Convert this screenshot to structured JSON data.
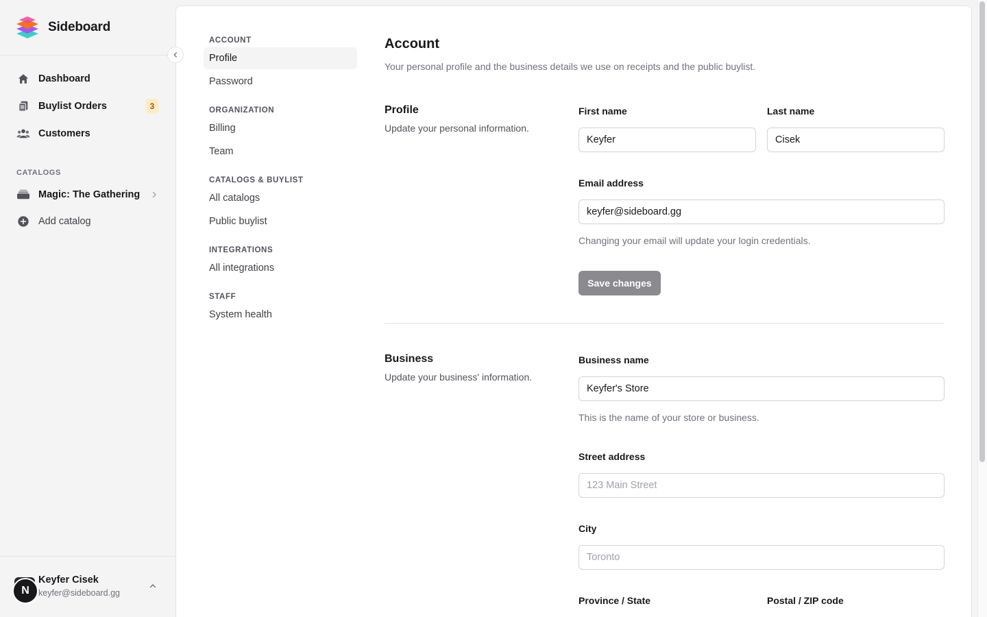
{
  "app": {
    "name": "Sideboard"
  },
  "sidebar": {
    "nav": [
      {
        "label": "Dashboard",
        "icon": "home-icon"
      },
      {
        "label": "Buylist Orders",
        "icon": "orders-icon",
        "badge": "3"
      },
      {
        "label": "Customers",
        "icon": "users-icon"
      }
    ],
    "catalogs_title": "CATALOGS",
    "catalogs": [
      {
        "label": "Magic: The Gathering",
        "icon": "stack-icon"
      },
      {
        "label": "Add catalog",
        "icon": "plus-circle-icon"
      }
    ],
    "user": {
      "initial": "N",
      "name": "Keyfer Cisek",
      "email": "keyfer@sideboard.gg"
    }
  },
  "settings_nav": {
    "sections": [
      {
        "title": "ACCOUNT",
        "items": [
          "Profile",
          "Password"
        ]
      },
      {
        "title": "ORGANIZATION",
        "items": [
          "Billing",
          "Team"
        ]
      },
      {
        "title": "CATALOGS & BUYLIST",
        "items": [
          "All catalogs",
          "Public buylist"
        ]
      },
      {
        "title": "INTEGRATIONS",
        "items": [
          "All integrations"
        ]
      },
      {
        "title": "STAFF",
        "items": [
          "System health"
        ]
      }
    ],
    "active": "Profile"
  },
  "page": {
    "title": "Account",
    "description": "Your personal profile and the business details we use on receipts and the public buylist."
  },
  "profile": {
    "title": "Profile",
    "description": "Update your personal information.",
    "first_name_label": "First name",
    "first_name_value": "Keyfer",
    "last_name_label": "Last name",
    "last_name_value": "Cisek",
    "email_label": "Email address",
    "email_value": "keyfer@sideboard.gg",
    "email_help": "Changing your email will update your login credentials.",
    "save_label": "Save changes"
  },
  "business": {
    "title": "Business",
    "description": "Update your business' information.",
    "name_label": "Business name",
    "name_value": "Keyfer's Store",
    "name_help": "This is the name of your store or business.",
    "street_label": "Street address",
    "street_placeholder": "123 Main Street",
    "city_label": "City",
    "city_placeholder": "Toronto",
    "province_label": "Province / State",
    "postal_label": "Postal / ZIP code"
  },
  "colors": {
    "accent_badge_bg": "#fdecc8",
    "accent_badge_text": "#b45309",
    "save_button_bg": "#8a8a8f"
  }
}
